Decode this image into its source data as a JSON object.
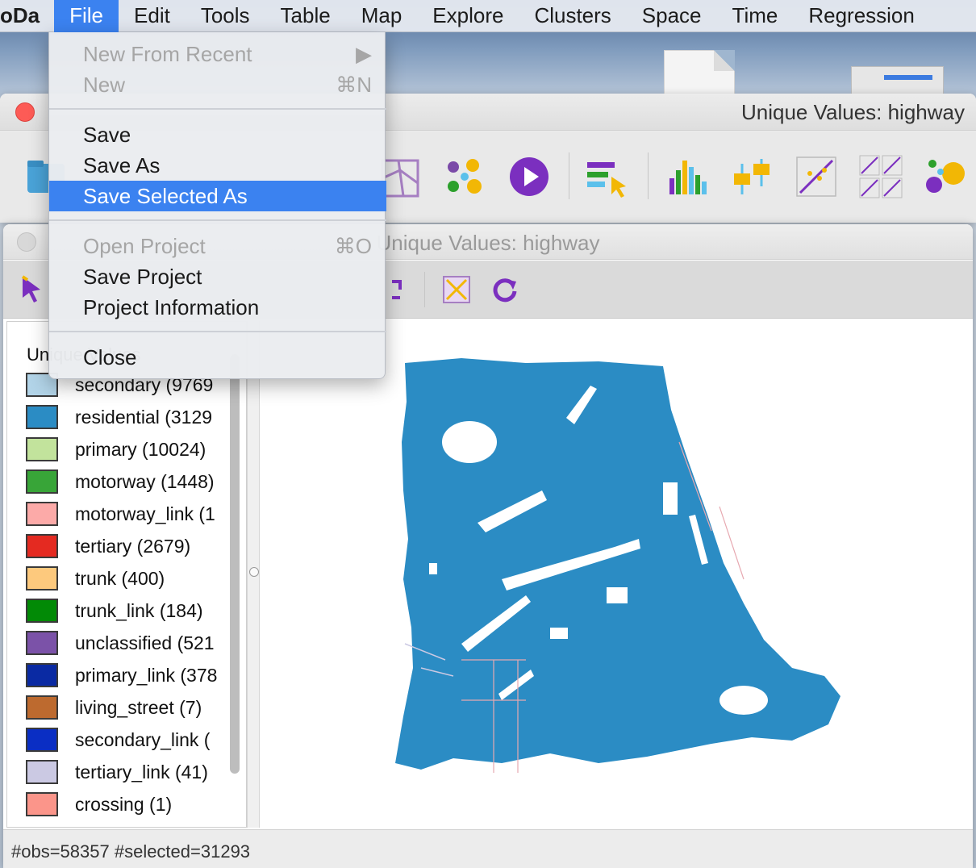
{
  "menubar": {
    "app": "oDa",
    "items": [
      "File",
      "Edit",
      "Tools",
      "Table",
      "Map",
      "Explore",
      "Clusters",
      "Space",
      "Time",
      "Regression"
    ],
    "active": "File"
  },
  "file_menu": {
    "items": [
      {
        "label": "New From Recent",
        "shortcut": "▶",
        "disabled": true
      },
      {
        "label": "New",
        "shortcut": "⌘N",
        "disabled": true
      },
      {
        "label": "Save",
        "shortcut": "",
        "disabled": false
      },
      {
        "label": "Save As",
        "shortcut": "",
        "disabled": false
      },
      {
        "label": "Save Selected As",
        "shortcut": "",
        "disabled": false,
        "highlighted": true
      },
      {
        "label": "Open Project",
        "shortcut": "⌘O",
        "disabled": true
      },
      {
        "label": "Save Project",
        "shortcut": "",
        "disabled": false
      },
      {
        "label": "Project Information",
        "shortcut": "",
        "disabled": false
      },
      {
        "label": "Close",
        "shortcut": "",
        "disabled": false
      }
    ]
  },
  "main_window": {
    "title": "Unique Values: highway"
  },
  "map_window": {
    "title": "Unique Values: highway",
    "legend_title": "Unique Values",
    "legend": [
      {
        "label": "secondary (9769",
        "color": "#b2d4e8"
      },
      {
        "label": "residential (3129",
        "color": "#2b8cc4"
      },
      {
        "label": "primary (10024)",
        "color": "#c2e39c"
      },
      {
        "label": "motorway (1448)",
        "color": "#38a538"
      },
      {
        "label": "motorway_link (1",
        "color": "#fcaaa8"
      },
      {
        "label": "tertiary (2679)",
        "color": "#e42a21"
      },
      {
        "label": "trunk (400)",
        "color": "#fdc97d"
      },
      {
        "label": "trunk_link (184)",
        "color": "#028a06"
      },
      {
        "label": "unclassified (521",
        "color": "#7b52a8"
      },
      {
        "label": "primary_link (378",
        "color": "#0a2aa3"
      },
      {
        "label": "living_street (7)",
        "color": "#bd6a2f"
      },
      {
        "label": "secondary_link (",
        "color": "#0a2ec4"
      },
      {
        "label": "tertiary_link (41)",
        "color": "#cbc9e3"
      },
      {
        "label": "crossing (1)",
        "color": "#fb958a"
      }
    ],
    "status": "#obs=58357 #selected=31293"
  },
  "colors": {
    "accent": "#3b82f0",
    "map_fill": "#2b8cc4"
  }
}
